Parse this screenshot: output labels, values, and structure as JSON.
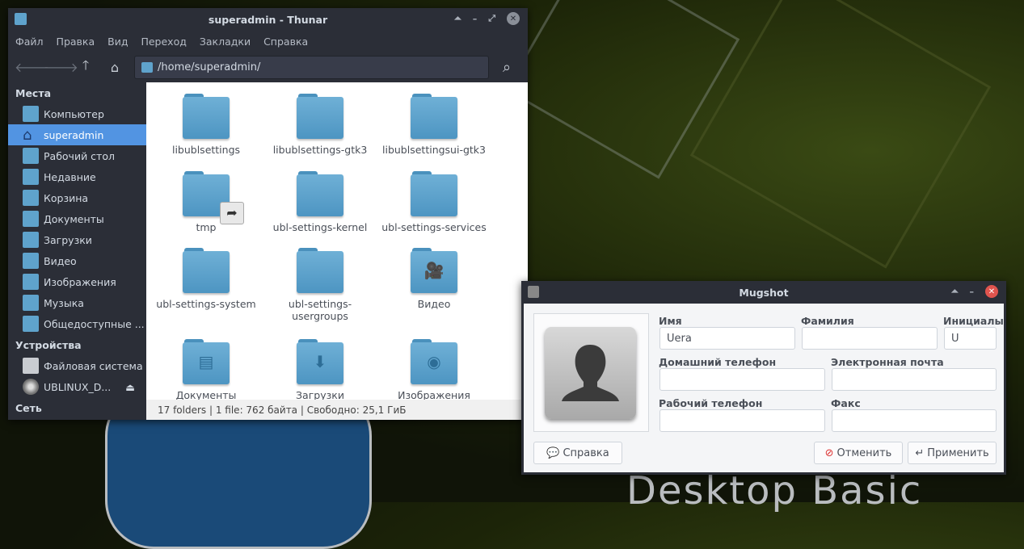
{
  "wallpaper": {
    "text": "Desktop Basic"
  },
  "thunar": {
    "title": "superadmin - Thunar",
    "menu": [
      "Файл",
      "Правка",
      "Вид",
      "Переход",
      "Закладки",
      "Справка"
    ],
    "location": "/home/superadmin/",
    "sidebar": {
      "places_header": "Места",
      "places": [
        {
          "label": "Компьютер",
          "icon": "computer-icon"
        },
        {
          "label": "superadmin",
          "icon": "home-icon",
          "selected": true
        },
        {
          "label": "Рабочий стол",
          "icon": "desktop-icon"
        },
        {
          "label": "Недавние",
          "icon": "recent-icon"
        },
        {
          "label": "Корзина",
          "icon": "trash-icon"
        },
        {
          "label": "Документы",
          "icon": "folder-icon"
        },
        {
          "label": "Загрузки",
          "icon": "folder-icon"
        },
        {
          "label": "Видео",
          "icon": "folder-icon"
        },
        {
          "label": "Изображения",
          "icon": "folder-icon"
        },
        {
          "label": "Музыка",
          "icon": "folder-icon"
        },
        {
          "label": "Общедоступные ...",
          "icon": "folder-icon"
        }
      ],
      "devices_header": "Устройства",
      "devices": [
        {
          "label": "Файловая система",
          "icon": "drive-icon"
        },
        {
          "label": "UBLINUX_D...",
          "icon": "disc-icon"
        }
      ],
      "network_header": "Сеть"
    },
    "files": [
      {
        "name": "libublsettings",
        "emblem": ""
      },
      {
        "name": "libublsettings-gtk3",
        "emblem": ""
      },
      {
        "name": "libublsettingsui-gtk3",
        "emblem": ""
      },
      {
        "name": "tmp",
        "emblem": "link"
      },
      {
        "name": "ubl-settings-kernel",
        "emblem": ""
      },
      {
        "name": "ubl-settings-services",
        "emblem": ""
      },
      {
        "name": "ubl-settings-system",
        "emblem": ""
      },
      {
        "name": "ubl-settings-usergroups",
        "emblem": ""
      },
      {
        "name": "Видео",
        "emblem": "video"
      },
      {
        "name": "Документы",
        "emblem": "document"
      },
      {
        "name": "Загрузки",
        "emblem": "download"
      },
      {
        "name": "Изображения",
        "emblem": "camera"
      }
    ],
    "status": "17 folders  |  1 file: 762 байта  |  Свободно: 25,1 ГиБ"
  },
  "mugshot": {
    "title": "Mugshot",
    "first_name_label": "Имя",
    "first_name": "Uera",
    "last_name_label": "Фамилия",
    "last_name": "",
    "initials_label": "Инициалы",
    "initials": "U",
    "home_phone_label": "Домашний телефон",
    "home_phone": "",
    "email_label": "Электронная почта",
    "email": "",
    "work_phone_label": "Рабочий телефон",
    "work_phone": "",
    "fax_label": "Факс",
    "fax": "",
    "help_button": "Справка",
    "cancel_button": "Отменить",
    "apply_button": "Применить"
  }
}
